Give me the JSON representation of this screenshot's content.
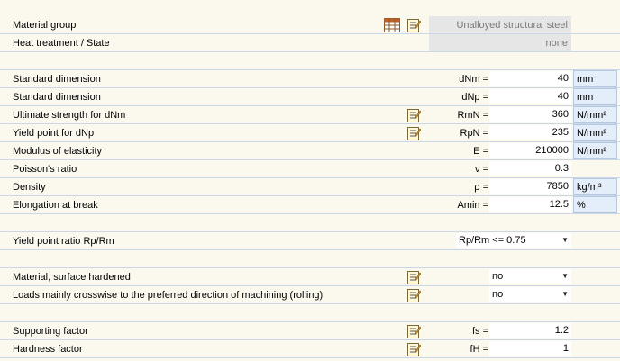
{
  "material": {
    "group_label": "Material group",
    "group_value": "Unalloyed structural steel",
    "heat_label": "Heat treatment / State",
    "heat_value": "none"
  },
  "params": [
    {
      "label": "Standard dimension",
      "symbol": "dNm =",
      "value": "40",
      "unit": "mm"
    },
    {
      "label": "Standard dimension",
      "symbol": "dNp =",
      "value": "40",
      "unit": "mm"
    },
    {
      "label": "Ultimate strength for dNm",
      "symbol": "RmN =",
      "value": "360",
      "unit": "N/mm²"
    },
    {
      "label": "Yield point for dNp",
      "symbol": "RpN =",
      "value": "235",
      "unit": "N/mm²"
    },
    {
      "label": "Modulus of elasticity",
      "symbol": "E =",
      "value": "210000",
      "unit": "N/mm²"
    },
    {
      "label": "Poisson's ratio",
      "symbol": "ν =",
      "value": "0.3",
      "unit": ""
    },
    {
      "label": "Density",
      "symbol": "ρ =",
      "value": "7850",
      "unit": "kg/m³"
    },
    {
      "label": "Elongation at break",
      "symbol": "Amin =",
      "value": "12.5",
      "unit": "%"
    }
  ],
  "yield_ratio": {
    "label": "Yield point ratio Rp/Rm",
    "value": "Rp/Rm <= 0.75"
  },
  "surface": {
    "label": "Material, surface hardened",
    "value": "no"
  },
  "crosswise": {
    "label": "Loads mainly crosswise to the preferred direction of machining (rolling)",
    "value": "no"
  },
  "factors": {
    "supporting_label": "Supporting factor",
    "supporting_symbol": "fs =",
    "supporting_value": "1.2",
    "hardness_label": "Hardness factor",
    "hardness_symbol": "fH =",
    "hardness_value": "1"
  },
  "icons": {
    "table": "table-icon",
    "edit": "edit-icon"
  }
}
